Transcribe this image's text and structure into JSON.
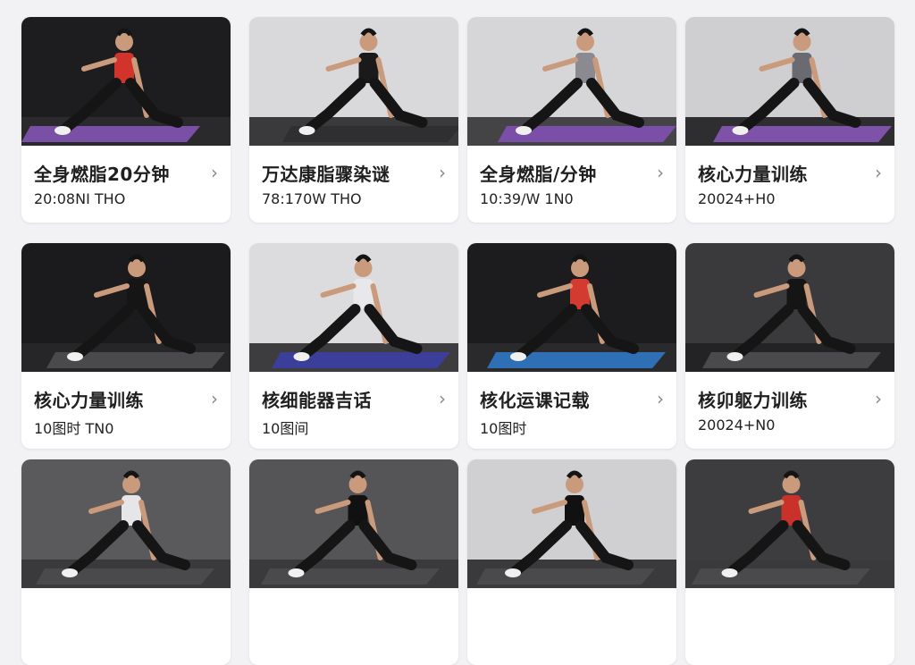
{
  "cards": [
    {
      "title": "全身燃脂20分钟",
      "subtitle": "20:08NI THO",
      "bg": "#1d1d1f",
      "floor": "#2a2a2c",
      "mat": "#7a4fa6",
      "top": "#d2332b"
    },
    {
      "title": "万达康脂骤染谜",
      "subtitle": "78:170W THO",
      "bg": "#d9d9db",
      "floor": "#3a3a3c",
      "mat": "#2f2f31",
      "top": "#1a1a1a"
    },
    {
      "title": "全身燃脂/分钟",
      "subtitle": "10:39/W 1N0",
      "bg": "#d6d6d8",
      "floor": "#444446",
      "mat": "#7b4fa7",
      "top": "#8a8a90"
    },
    {
      "title": "核心力量训练",
      "subtitle": "20024+H0",
      "bg": "#cfcfd1",
      "floor": "#2e2e30",
      "mat": "#7d52a8",
      "top": "#6a6a72"
    },
    {
      "title": "核心力量训练",
      "subtitle": "10图时 TN0",
      "bg": "#1b1b1d",
      "floor": "#262628",
      "mat": "#4a4a4c",
      "top": "#151515"
    },
    {
      "title": "核细能器吉话",
      "subtitle": "10图间",
      "bg": "#dcdcde",
      "floor": "#3d3d3f",
      "mat": "#3b3f9a",
      "top": "#e8e8ea"
    },
    {
      "title": "核化运课记载",
      "subtitle": "10图时",
      "bg": "#1c1c1e",
      "floor": "#2a2a2c",
      "mat": "#2f6fb6",
      "top": "#d33a30"
    },
    {
      "title": "核卯躯力训练",
      "subtitle": "20024+N0",
      "bg": "#3a3a3c",
      "floor": "#232325",
      "mat": "#4a4a4c",
      "top": "#151515"
    },
    {
      "title": "",
      "subtitle": "",
      "bg": "#5a5a5c",
      "floor": "#3a3a3c",
      "mat": "#4a4a4c",
      "top": "#e6e6e8"
    },
    {
      "title": "",
      "subtitle": "",
      "bg": "#555557",
      "floor": "#3a3a3c",
      "mat": "#4a4a4c",
      "top": "#111"
    },
    {
      "title": "",
      "subtitle": "",
      "bg": "#d0d0d2",
      "floor": "#3a3a3c",
      "mat": "#4a4a4c",
      "top": "#111"
    },
    {
      "title": "",
      "subtitle": "",
      "bg": "#3d3d3f",
      "floor": "#3a3a3c",
      "mat": "#4a4a4c",
      "top": "#c8322a"
    }
  ],
  "chevron": "›"
}
